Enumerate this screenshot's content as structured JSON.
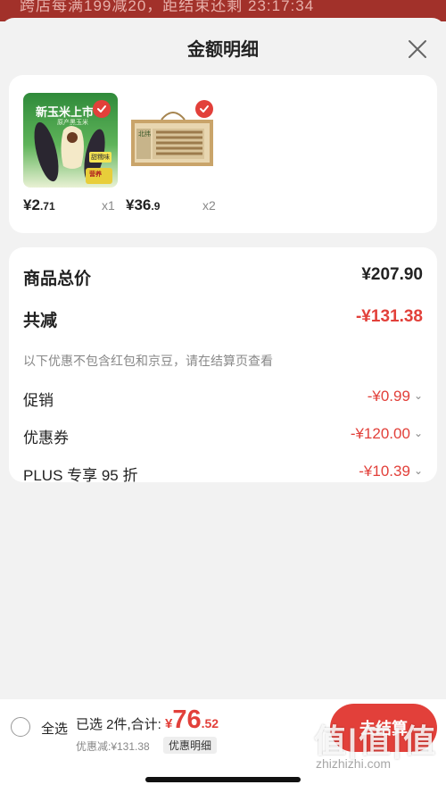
{
  "banner": {
    "text": "跨店每满199减20，距结束还剩 23:17:34"
  },
  "header": {
    "title": "金额明细"
  },
  "products": [
    {
      "image_text": "新玉米上市",
      "image_sub": "原产黑玉米",
      "image_badge": "甜糯味",
      "image_tag": "营养",
      "price_int": "2",
      "price_dec": ".71",
      "currency": "¥",
      "qty": "x1"
    },
    {
      "image_text": "北纬",
      "image_sub": "",
      "image_badge": "",
      "image_tag": "",
      "price_int": "36",
      "price_dec": ".9",
      "currency": "¥",
      "qty": "x2"
    }
  ],
  "summary": {
    "goods_total_label": "商品总价",
    "goods_total_value": "¥207.90",
    "reduce_label": "共减",
    "reduce_value": "-¥131.38",
    "reduce_note": "以下优惠不包含红包和京豆，请在结算页查看",
    "items": [
      {
        "label": "促销",
        "value": "-¥0.99"
      },
      {
        "label": "优惠券",
        "value": "-¥120.00"
      },
      {
        "label": "PLUS 专享 95 折",
        "value": "-¥10.39"
      }
    ]
  },
  "footer": {
    "select_all": "全选",
    "selected_info": "已选 2件,合计:",
    "total_currency": "¥",
    "total_int": "76",
    "total_dec": ".52",
    "saved": "优惠减:¥131.38",
    "detail_tag": "优惠明细",
    "checkout": "去结算"
  },
  "watermark": {
    "main": "值|值|值",
    "site": "zhizhizhi.com"
  },
  "colors": {
    "accent": "#e2403a",
    "banner": "#a2312a",
    "background": "#f2f2f2"
  }
}
